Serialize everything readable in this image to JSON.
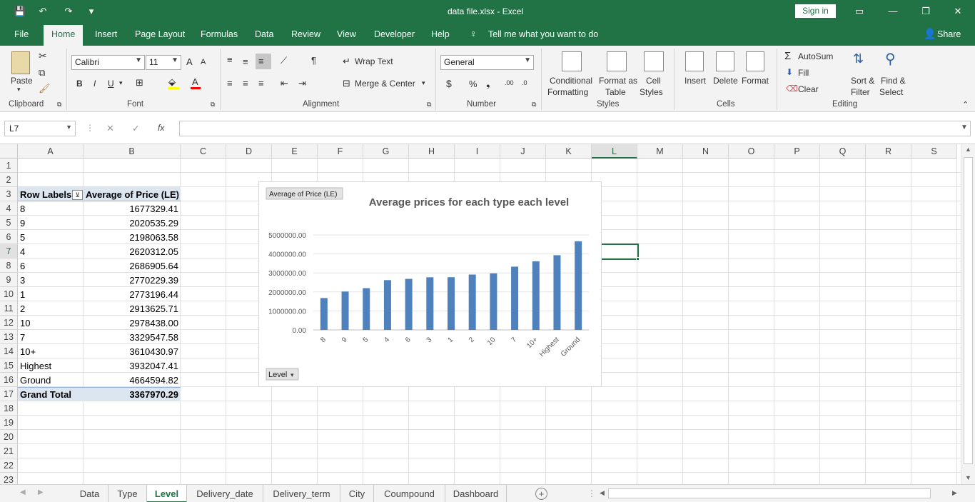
{
  "titlebar": {
    "title": "data file.xlsx  -  Excel",
    "signin": "Sign in",
    "save_glyph": "💾",
    "undo_glyph": "↶",
    "redo_glyph": "↷",
    "customize_glyph": "▾",
    "ribbon_display_glyph": "▭",
    "minimize_glyph": "—",
    "restore_glyph": "❐",
    "close_glyph": "✕"
  },
  "tabs": [
    "File",
    "Home",
    "Insert",
    "Page Layout",
    "Formulas",
    "Data",
    "Review",
    "View",
    "Developer",
    "Help"
  ],
  "tell_me": "Tell me what you want to do",
  "share": "Share",
  "ribbon": {
    "clipboard": {
      "label": "Clipboard",
      "paste": "Paste"
    },
    "font": {
      "label": "Font",
      "name": "Calibri",
      "size": "11",
      "bold": "B",
      "italic": "I",
      "underline": "U",
      "grow": "A",
      "shrink": "A"
    },
    "alignment": {
      "label": "Alignment",
      "wrap": "Wrap Text",
      "merge": "Merge & Center"
    },
    "number": {
      "label": "Number",
      "format": "General",
      "currency": "$",
      "percent": "%",
      "comma": "❟",
      "inc": ".00",
      "dec": ".0"
    },
    "styles": {
      "label": "Styles",
      "conditional1": "Conditional",
      "conditional2": "Formatting",
      "format_as1": "Format as",
      "format_as2": "Table",
      "cell1": "Cell",
      "cell2": "Styles"
    },
    "cells": {
      "label": "Cells",
      "insert": "Insert",
      "delete": "Delete",
      "format": "Format"
    },
    "editing": {
      "label": "Editing",
      "autosum": "AutoSum",
      "fill": "Fill",
      "clear": "Clear",
      "sort1": "Sort &",
      "sort2": "Filter",
      "find1": "Find &",
      "find2": "Select"
    }
  },
  "formula_bar": {
    "name_box": "L7",
    "cancel": "✕",
    "enter": "✓",
    "fx": "fx",
    "value": ""
  },
  "columns": [
    "A",
    "B",
    "C",
    "D",
    "E",
    "F",
    "G",
    "H",
    "I",
    "J",
    "K",
    "L",
    "M",
    "N",
    "O",
    "P",
    "Q",
    "R",
    "S"
  ],
  "rows": [
    "1",
    "2",
    "3",
    "4",
    "5",
    "6",
    "7",
    "8",
    "9",
    "10",
    "11",
    "12",
    "13",
    "14",
    "15",
    "16",
    "17",
    "18",
    "19",
    "20",
    "21",
    "22",
    "23"
  ],
  "pivot": {
    "header_labels": "Row Labels",
    "header_values": "Average of Price (LE)",
    "filter_glyph": "⊻",
    "rows": [
      {
        "label": "8",
        "value": "1677329.41"
      },
      {
        "label": "9",
        "value": "2020535.29"
      },
      {
        "label": "5",
        "value": "2198063.58"
      },
      {
        "label": "4",
        "value": "2620312.05"
      },
      {
        "label": "6",
        "value": "2686905.64"
      },
      {
        "label": "3",
        "value": "2770229.39"
      },
      {
        "label": "1",
        "value": "2773196.44"
      },
      {
        "label": "2",
        "value": "2913625.71"
      },
      {
        "label": "10",
        "value": "2978438.00"
      },
      {
        "label": "7",
        "value": "3329547.58"
      },
      {
        "label": "10+",
        "value": "3610430.97"
      },
      {
        "label": "Highest",
        "value": "3932047.41"
      },
      {
        "label": "Ground",
        "value": "4664594.82"
      }
    ],
    "grand_label": "Grand Total",
    "grand_value": "3367970.29"
  },
  "chart_data": {
    "type": "bar",
    "title": "Average prices for each type each level",
    "field_button": "Average of Price (LE)",
    "axis_button": "Level",
    "axis_button_glyph": "▾",
    "categories": [
      "8",
      "9",
      "5",
      "4",
      "6",
      "3",
      "1",
      "2",
      "10",
      "7",
      "10+",
      "Highest",
      "Ground"
    ],
    "values": [
      1677329.41,
      2020535.29,
      2198063.58,
      2620312.05,
      2686905.64,
      2770229.39,
      2773196.44,
      2913625.71,
      2978438.0,
      3329547.58,
      3610430.97,
      3932047.41,
      4664594.82
    ],
    "ylim": [
      0,
      5000000
    ],
    "yticks": [
      "0.00",
      "1000000.00",
      "2000000.00",
      "3000000.00",
      "4000000.00",
      "5000000.00"
    ],
    "grid": true,
    "bar_color": "#4f81bd"
  },
  "sheets": [
    "Data",
    "Type",
    "Level",
    "Delivery_date",
    "Delivery_term",
    "City",
    "Coumpound",
    "Dashboard"
  ],
  "active_sheet": "Level",
  "add_sheet_glyph": "+",
  "colors": {
    "accent": "#217346",
    "header_fill": "#dce6f1"
  }
}
